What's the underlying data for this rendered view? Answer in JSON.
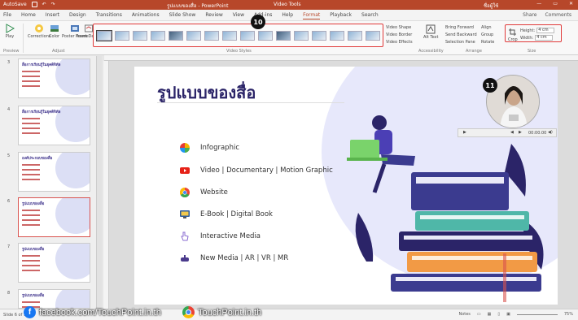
{
  "titlebar": {
    "autosave": "AutoSave",
    "doc_title": "รูปแบบของสื่อ - PowerPoint",
    "context_tab": "Video Tools",
    "user": "ชื่อผู้ใช้",
    "minimize": "—",
    "restore": "▭",
    "close": "✕"
  },
  "menu": {
    "tabs": [
      "File",
      "Home",
      "Insert",
      "Design",
      "Transitions",
      "Animations",
      "Slide Show",
      "Review",
      "View",
      "Add-ins",
      "Help",
      "Format",
      "Playback",
      "Search"
    ],
    "active_tab": "Format",
    "share": "Share",
    "comments": "Comments"
  },
  "ribbon": {
    "play": "Play",
    "corrections": "Corrections",
    "color": "Color",
    "poster_frame": "Poster Frame",
    "reset_design": "Reset Design",
    "group_preview": "Preview",
    "group_adjust": "Adjust",
    "group_styles": "Video Styles",
    "video_shape": "Video Shape",
    "video_border": "Video Border",
    "video_effects": "Video Effects",
    "alt_text": "Alt Text",
    "group_accessibility": "Accessibility",
    "bring_forward": "Bring Forward",
    "send_backward": "Send Backward",
    "selection_pane": "Selection Pane",
    "align": "Align",
    "group": "Group",
    "rotate": "Rotate",
    "group_arrange": "Arrange",
    "crop": "Crop",
    "height_label": "Height:",
    "height_value": "4 cm",
    "width_label": "Width:",
    "width_value": "4 cm",
    "group_size": "Size"
  },
  "badges": {
    "ribbon": "10",
    "video": "11"
  },
  "slides": [
    {
      "num": "3",
      "title": "สื่อการเรียนรู้ในยุคดิจิทัล"
    },
    {
      "num": "4",
      "title": "สื่อการเรียนรู้ในยุคดิจิทัล"
    },
    {
      "num": "5",
      "title": "องค์ประกอบของสื่อ"
    },
    {
      "num": "6",
      "title": "รูปแบบของสื่อ"
    },
    {
      "num": "7",
      "title": "รูปแบบของสื่อ"
    },
    {
      "num": "8",
      "title": "รูปแบบของสื่อ"
    }
  ],
  "slide": {
    "title": "รูปแบบของสื่อ",
    "bullets": [
      "Infographic",
      "Video | Documentary | Motion Graphic",
      "Website",
      "E-Book | Digital Book",
      "Interactive Media",
      "New Media | AR | VR | MR"
    ]
  },
  "video_bar": {
    "time": "00:00.00"
  },
  "status": {
    "slide_info": "Slide 6 of 12",
    "notes": "Notes",
    "zoom": "75%"
  },
  "watermark": {
    "facebook": "facebook.com/TouchPoint.in.th",
    "website": "TouchPoint.in.th"
  },
  "colors": {
    "accent": "#b7472a",
    "title": "#2b2468",
    "highlight": "#e03a3a"
  }
}
